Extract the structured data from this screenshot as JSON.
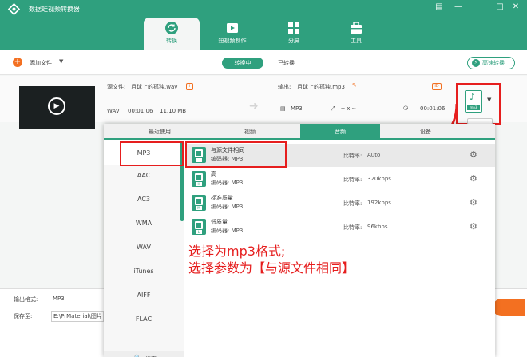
{
  "app": {
    "title": "数据蛙视频转换器",
    "window_controls": [
      "▤",
      "—",
      "□",
      "✕"
    ]
  },
  "nav": {
    "tabs": [
      {
        "label": "转换",
        "icon": "refresh-icon",
        "active": true
      },
      {
        "label": "短视频制作",
        "icon": "video-edit-icon",
        "active": false
      },
      {
        "label": "分屏",
        "icon": "grid-icon",
        "active": false
      },
      {
        "label": "工具",
        "icon": "toolbox-icon",
        "active": false
      }
    ]
  },
  "toolbar": {
    "add_label": "添加文件",
    "add_icon": "+",
    "dropdown": "▼",
    "seg_converting": "转换中",
    "seg_converted": "已转换",
    "fast_label": "高速转换",
    "fast_icon": "⚡"
  },
  "file": {
    "source_label": "源文件:",
    "source_name": "月球上的孤独.wav",
    "output_label": "输出:",
    "output_name": "月球上的孤独.mp3",
    "src_format": "WAV",
    "src_duration": "00:01:06",
    "src_size": "11.10 MB",
    "out_format": "MP3",
    "out_res": "-- x --",
    "out_duration": "00:01:06",
    "play_icon": "▶",
    "out_icon_label": "mp3",
    "out_icon_glyph": "♪",
    "out_dropdown": "▼"
  },
  "panel": {
    "tabs": [
      "最近使用",
      "视频",
      "音频",
      "设备"
    ],
    "active_tab": 2,
    "formats": [
      "MP3",
      "AAC",
      "AC3",
      "WMA",
      "WAV",
      "iTunes",
      "AIFF",
      "FLAC"
    ],
    "selected_format": 0,
    "search_label": "搜索",
    "search_icon": "🔍",
    "qualities": [
      {
        "name": "与源文件相同",
        "encoder": "编码器: MP3",
        "bitrate_label": "比特率:",
        "bitrate": "Auto",
        "tag": ""
      },
      {
        "name": "高",
        "encoder": "编码器: MP3",
        "bitrate_label": "比特率:",
        "bitrate": "320kbps",
        "tag": "H"
      },
      {
        "name": "标准质量",
        "encoder": "编码器: MP3",
        "bitrate_label": "比特率:",
        "bitrate": "192kbps",
        "tag": "M"
      },
      {
        "name": "低质量",
        "encoder": "编码器: MP3",
        "bitrate_label": "比特率:",
        "bitrate": "96kbps",
        "tag": "L"
      }
    ],
    "gear_icon": "⚙"
  },
  "bottom": {
    "output_format_label": "输出格式:",
    "output_format_value": "MP3",
    "save_label": "保存至:",
    "save_path": "E:\\PrMaterial\\图片"
  },
  "annotation": {
    "line1": "选择为mp3格式;",
    "line2": "选择参数为【与源文件相同】",
    "color": "#e61e1e"
  },
  "colors": {
    "accent": "#2fa07e",
    "orange": "#f37021",
    "annotation_red": "#e61e1e"
  }
}
